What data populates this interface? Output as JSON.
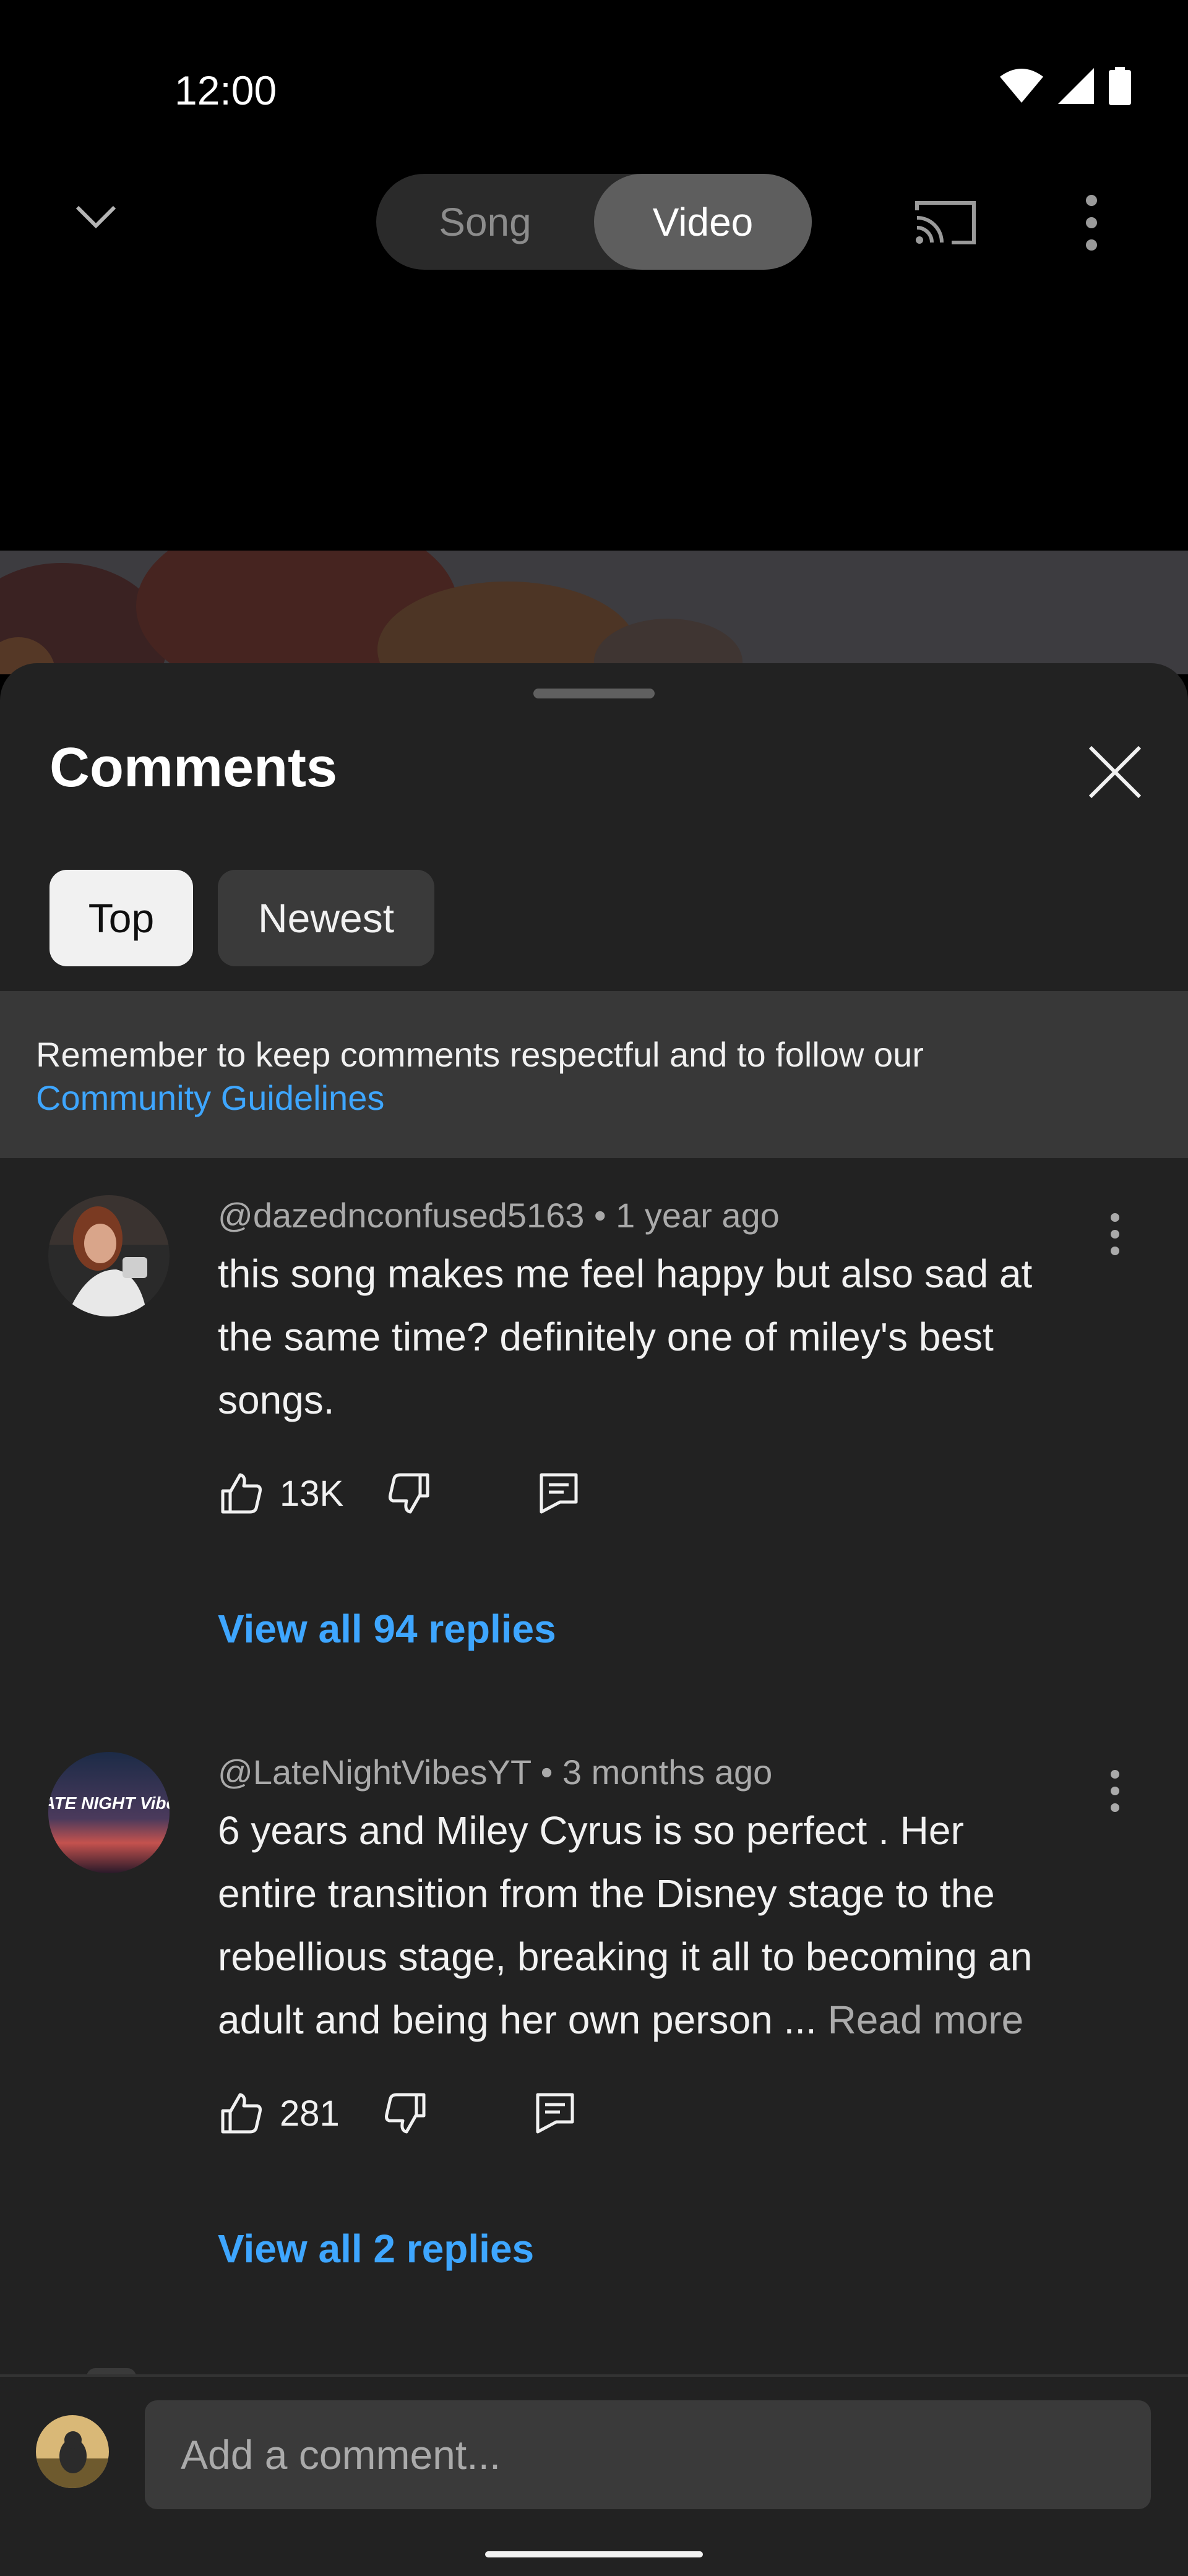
{
  "status_bar": {
    "time": "12:00"
  },
  "header": {
    "segments": [
      "Song",
      "Video"
    ],
    "selected": "Video"
  },
  "comments_sheet": {
    "title": "Comments",
    "sort_chips": [
      "Top",
      "Newest"
    ],
    "selected_chip": "Top",
    "notice": {
      "text": "Remember to keep comments respectful and to follow our",
      "link": "Community Guidelines"
    },
    "comments": [
      {
        "author": "@dazednconfused5163",
        "age": "1 year ago",
        "text_lines": [
          "this song makes me feel happy but also sad at",
          "the same time? definitely one of miley's best",
          "songs."
        ],
        "likes": "13K",
        "replies_label": "View all 94 replies"
      },
      {
        "author": "@LateNightVibesYT",
        "age": "3 months ago",
        "text_lines": [
          "6 years and Miley Cyrus is so perfect . Her",
          "entire transition from the Disney stage to the",
          "rebellious stage, breaking it all to becoming an",
          "adult and being her own person ..."
        ],
        "read_more": "Read more",
        "likes": "281",
        "replies_label": "View all 2 replies",
        "avatar_text": "LATE NIGHT Vibes"
      }
    ],
    "input_placeholder": "Add a comment..."
  },
  "colors": {
    "link": "#3ea6ff",
    "sheet_bg": "#222222",
    "banner_bg": "#383838"
  }
}
